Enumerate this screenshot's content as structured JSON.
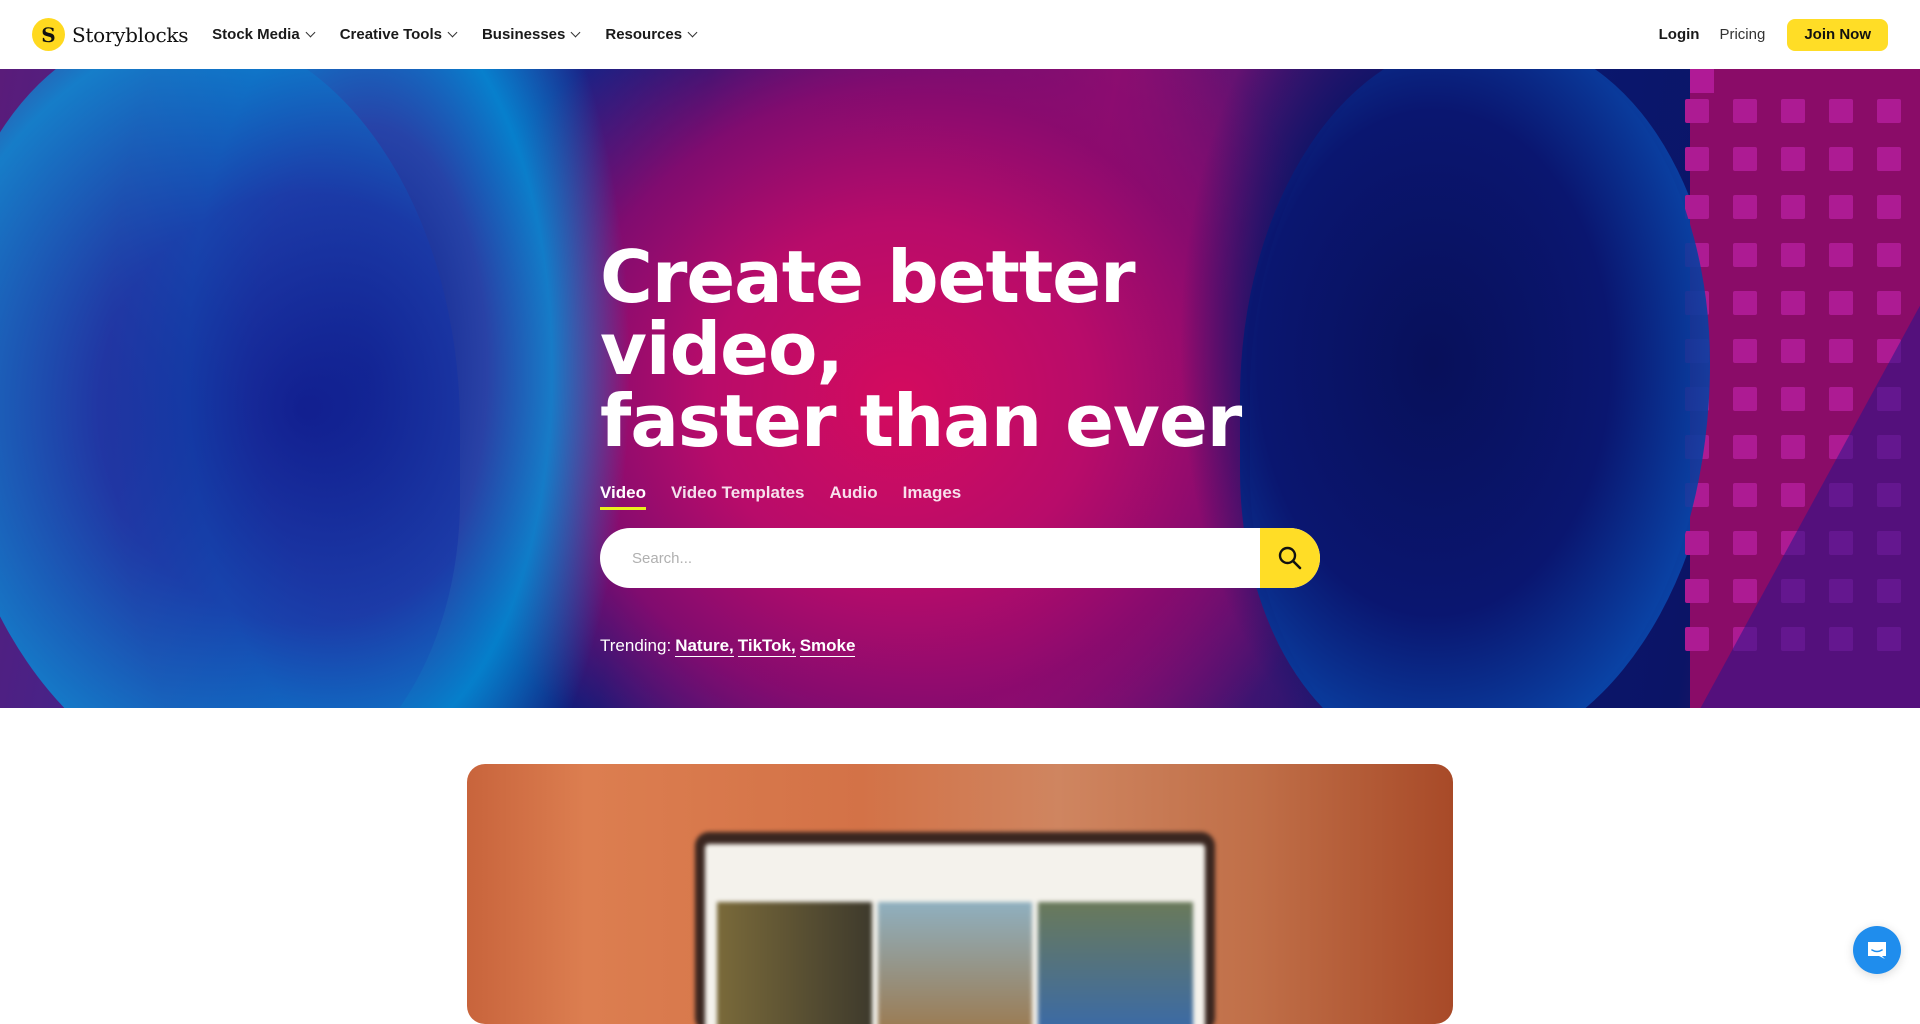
{
  "brand": {
    "name": "Storyblocks",
    "logo_glyph": "S",
    "accent_color": "#ffdd26"
  },
  "nav": {
    "menu": [
      {
        "label": "Stock Media",
        "icon": "chevron-down-icon"
      },
      {
        "label": "Creative Tools",
        "icon": "chevron-down-icon"
      },
      {
        "label": "Businesses",
        "icon": "chevron-down-icon"
      },
      {
        "label": "Resources",
        "icon": "chevron-down-icon"
      }
    ],
    "login": "Login",
    "pricing": "Pricing",
    "join": "Join Now"
  },
  "hero": {
    "headline_line1": "Create better video,",
    "headline_line2": "faster than ever",
    "tabs": [
      {
        "label": "Video",
        "active": true
      },
      {
        "label": "Video Templates",
        "active": false
      },
      {
        "label": "Audio",
        "active": false
      },
      {
        "label": "Images",
        "active": false
      }
    ],
    "search": {
      "placeholder": "Search...",
      "value": "",
      "button_icon": "search-icon"
    },
    "trending": {
      "label": "Trending:",
      "items": [
        "Nature,",
        "TikTok,",
        "Smoke"
      ]
    }
  },
  "chat": {
    "icon": "chat-icon",
    "color": "#1f8ded"
  }
}
